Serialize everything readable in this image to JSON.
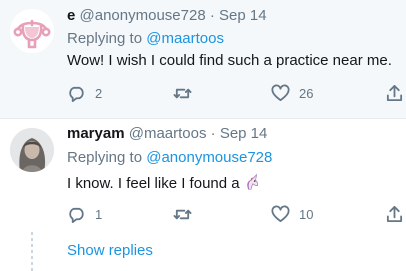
{
  "tweets": [
    {
      "name": "e",
      "handle": "@anonymouse728",
      "separator": "·",
      "date": "Sep 14",
      "replying_prefix": "Replying to ",
      "replying_to": "@maartoos",
      "text": "Wow! I wish I could find such a practice near me.",
      "reply_count": "2",
      "retweet_count": "",
      "like_count": "26",
      "avatar_icon": "uterus-icon"
    },
    {
      "name": "maryam",
      "handle": "@maartoos",
      "separator": "·",
      "date": "Sep 14",
      "replying_prefix": "Replying to ",
      "replying_to": "@anonymouse728",
      "text": "I know. I feel like I found a",
      "emoji_icon": "unicorn-icon",
      "reply_count": "1",
      "retweet_count": "",
      "like_count": "10",
      "avatar_icon": "user-photo"
    }
  ],
  "show_replies_label": "Show replies",
  "colors": {
    "link": "#1b95e0",
    "muted": "#657786",
    "highlight_bg": "#f5f8fa",
    "accent_pink": "#e8a0b8"
  }
}
